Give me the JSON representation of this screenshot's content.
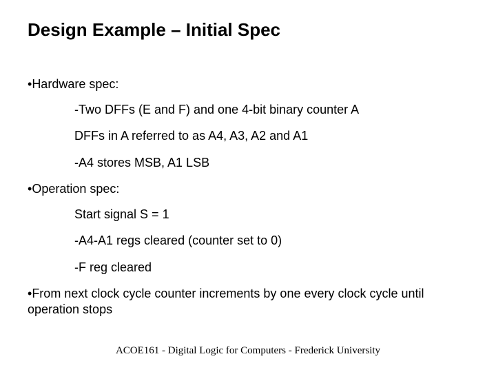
{
  "title": "Design Example – Initial Spec",
  "body": {
    "p1": "Hardware spec:",
    "p1a": "-Two DFFs (E and F) and one 4-bit binary counter A",
    "p1b": "DFFs in A referred to as A4, A3, A2 and A1",
    "p1c": "-A4 stores MSB, A1 LSB",
    "p2": "Operation spec:",
    "p2a": "Start signal S = 1",
    "p2b": "-A4-A1 regs cleared (counter set to 0)",
    "p2c": "-F reg cleared",
    "p3": "From next clock cycle counter increments by one every clock cycle until operation stops"
  },
  "footer": "ACOE161 - Digital Logic for Computers - Frederick University",
  "bullet": "•"
}
